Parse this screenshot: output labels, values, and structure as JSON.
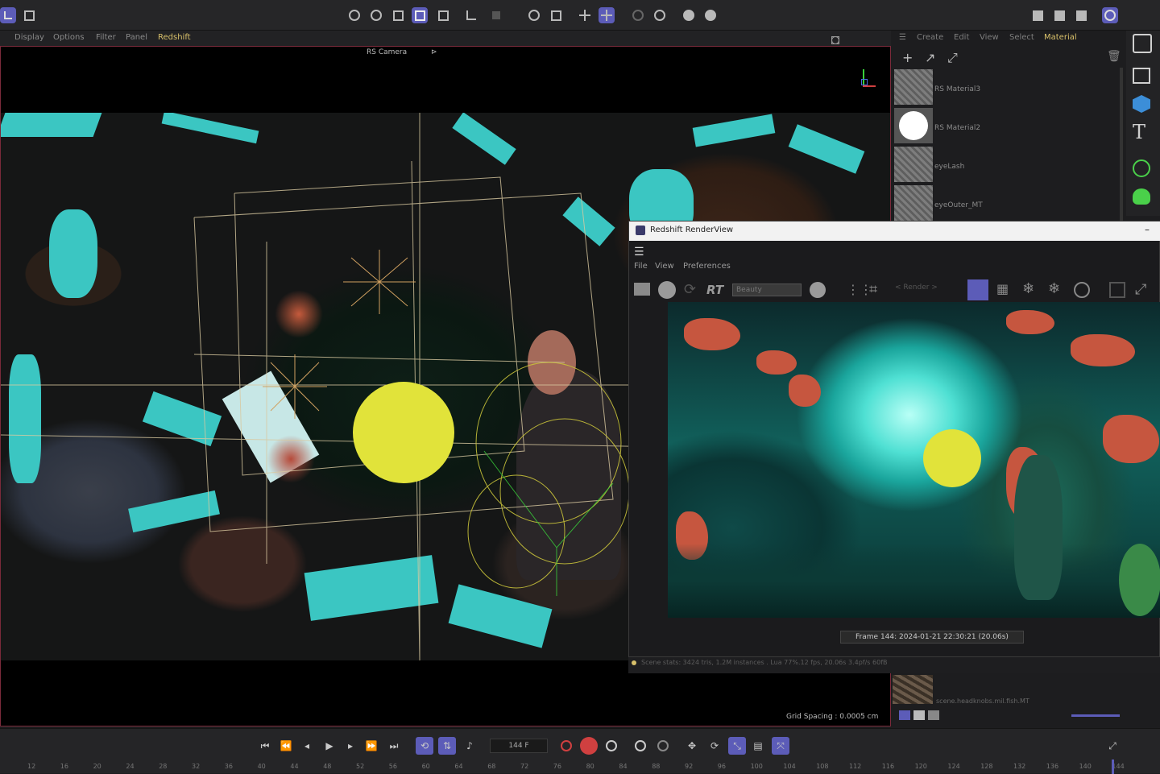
{
  "viewport_menu": [
    "Display",
    "Options",
    "Filter",
    "Panel",
    "Redshift"
  ],
  "viewport": {
    "camera_label": "RS Camera",
    "camera_icon": "camera-arrow-icon",
    "grid_spacing": "Grid Spacing : 0.0005 cm"
  },
  "material_panel": {
    "menu": [
      "Create",
      "Edit",
      "View",
      "Select",
      "Material"
    ],
    "active_menu": "Material",
    "materials": [
      {
        "name": "RS Material3"
      },
      {
        "name": "RS Material2"
      },
      {
        "name": "eyeLash"
      },
      {
        "name": "eyeOuter_MT"
      }
    ],
    "bottom_material": "scene.headknobs.mil.fish.MT"
  },
  "render_view": {
    "title": "Redshift RenderView",
    "menu": [
      "File",
      "View",
      "Preferences"
    ],
    "rt_label": "RT",
    "aov_select": "Beauty",
    "render_select": "< Render >",
    "status": "Frame  144:  2024-01-21  22:30:21  (20.06s)",
    "log_line": "Scene stats: 3424 tris, 1.2M instances  .  Lua 77%.12 fps, 20.06s   3.4pf/s  60fB"
  },
  "timeline": {
    "current_frame": "144 F",
    "ruler": [
      "12",
      "16",
      "20",
      "24",
      "28",
      "32",
      "36",
      "40",
      "44",
      "48",
      "52",
      "56",
      "60",
      "64",
      "68",
      "72",
      "76",
      "80",
      "84",
      "88",
      "92",
      "96",
      "100",
      "104",
      "108",
      "112",
      "116",
      "120",
      "124",
      "128",
      "132",
      "136",
      "140",
      "144"
    ]
  },
  "colors": {
    "accent": "#5c5cb8",
    "viewport_border": "#7a2a3a",
    "sun": "#e1e33a",
    "teal": "#3bc6c2"
  }
}
